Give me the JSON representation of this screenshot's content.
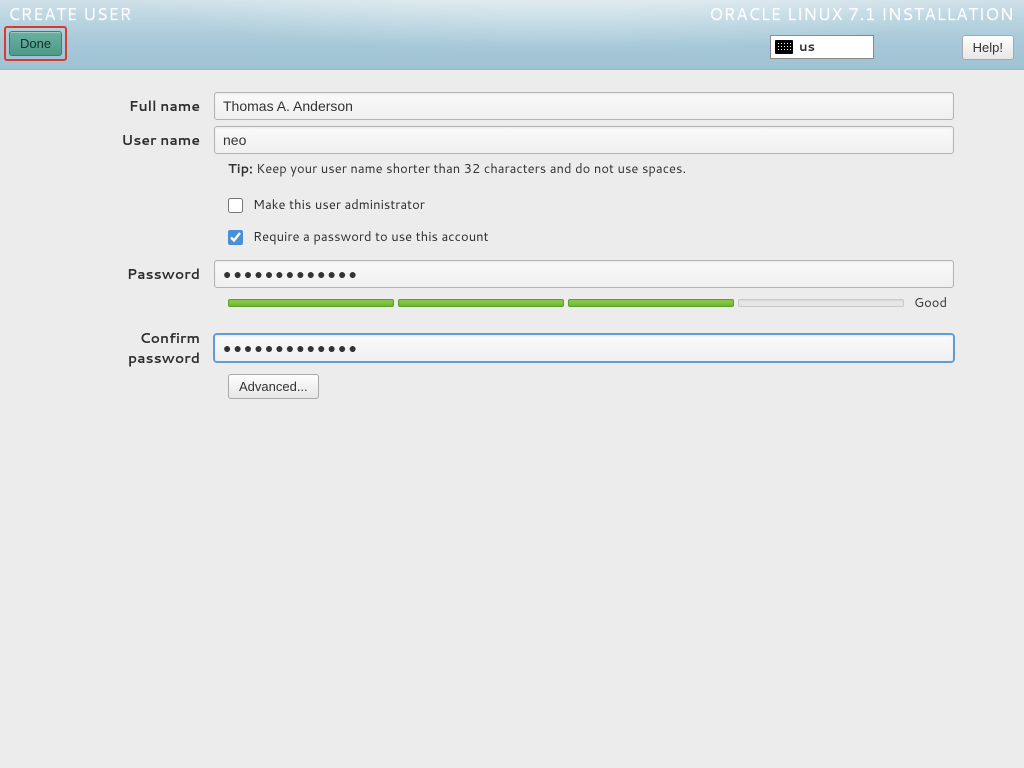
{
  "header": {
    "screen_title": "CREATE USER",
    "product_title": "ORACLE LINUX 7.1 INSTALLATION",
    "done_label": "Done",
    "help_label": "Help!",
    "keyboard_layout": "us"
  },
  "form": {
    "fullname_label": "Full name",
    "fullname_value": "Thomas A. Anderson",
    "username_label": "User name",
    "username_value": "neo",
    "tip_prefix": "Tip:",
    "tip_text": " Keep your user name shorter than 32 characters and do not use spaces.",
    "admin_checkbox_label": "Make this user administrator",
    "admin_checked": false,
    "require_pw_label": "Require a password to use this account",
    "require_pw_checked": true,
    "password_label": "Password",
    "password_value": "●●●●●●●●●●●●●",
    "confirm_label": "Confirm password",
    "confirm_value": "●●●●●●●●●●●●●",
    "strength_segments_on": 3,
    "strength_segments_total": 4,
    "strength_text": "Good",
    "advanced_label": "Advanced..."
  }
}
